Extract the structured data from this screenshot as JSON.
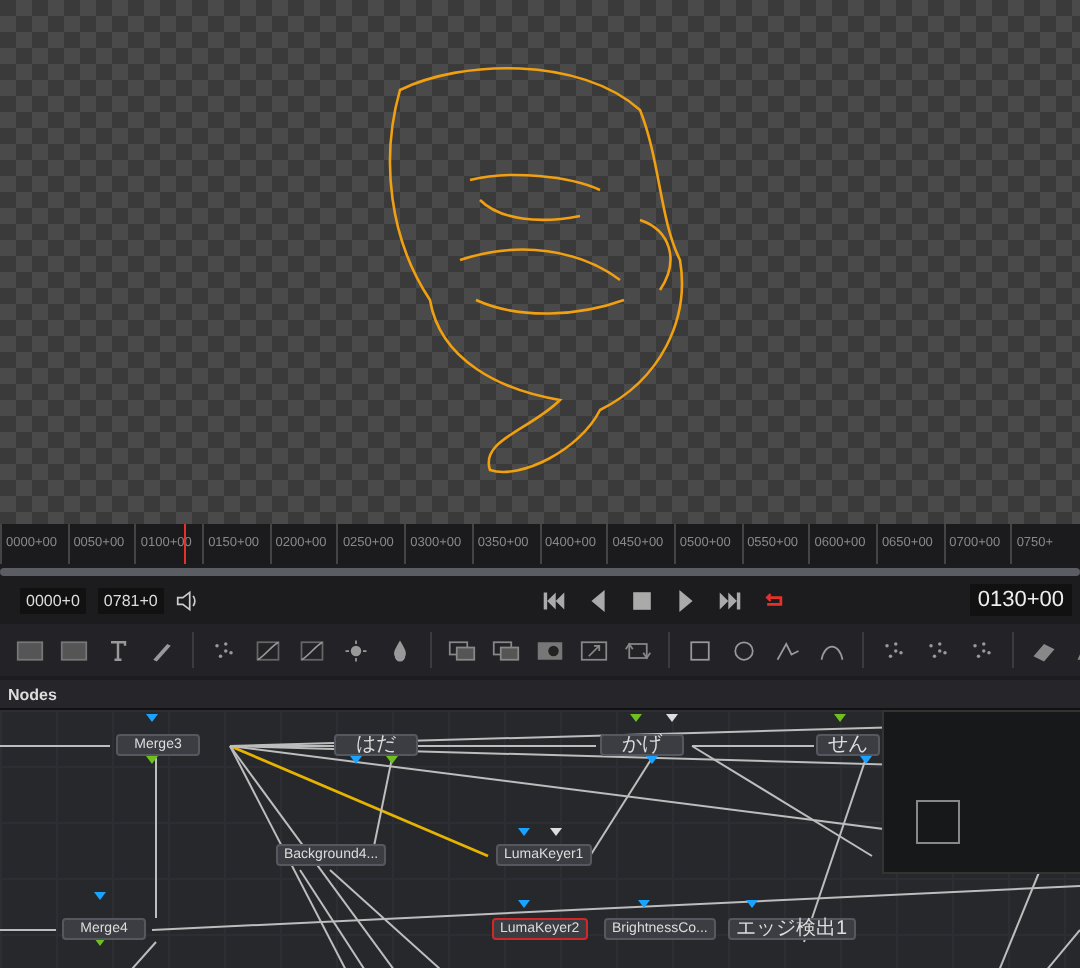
{
  "viewer": {
    "kind": "transparent"
  },
  "timeline": {
    "ticks": [
      "0000+00",
      "0050+00",
      "0100+00",
      "0150+00",
      "0200+00",
      "0250+00",
      "0300+00",
      "0350+00",
      "0400+00",
      "0450+00",
      "0500+00",
      "0550+00",
      "0600+00",
      "0650+00",
      "0700+00",
      "0750+"
    ],
    "level": 0.17
  },
  "transport": {
    "start": "0000+0",
    "end": "0781+0",
    "loop_on": true,
    "current": "0130+00"
  },
  "nodes_panel": {
    "title": "Nodes",
    "nodes": [
      {
        "label": "Merge3",
        "selected": false
      },
      {
        "label": "はだ",
        "selected": false
      },
      {
        "label": "かげ",
        "selected": false
      },
      {
        "label": "せん",
        "selected": false
      },
      {
        "label": "Background4...",
        "selected": false
      },
      {
        "label": "LumaKeyer1",
        "selected": false
      },
      {
        "label": "Merge4",
        "selected": false
      },
      {
        "label": "LumaKeyer2",
        "selected": true
      },
      {
        "label": "BrightnessCo...",
        "selected": false
      },
      {
        "label": "エッジ検出1",
        "selected": false
      }
    ]
  }
}
